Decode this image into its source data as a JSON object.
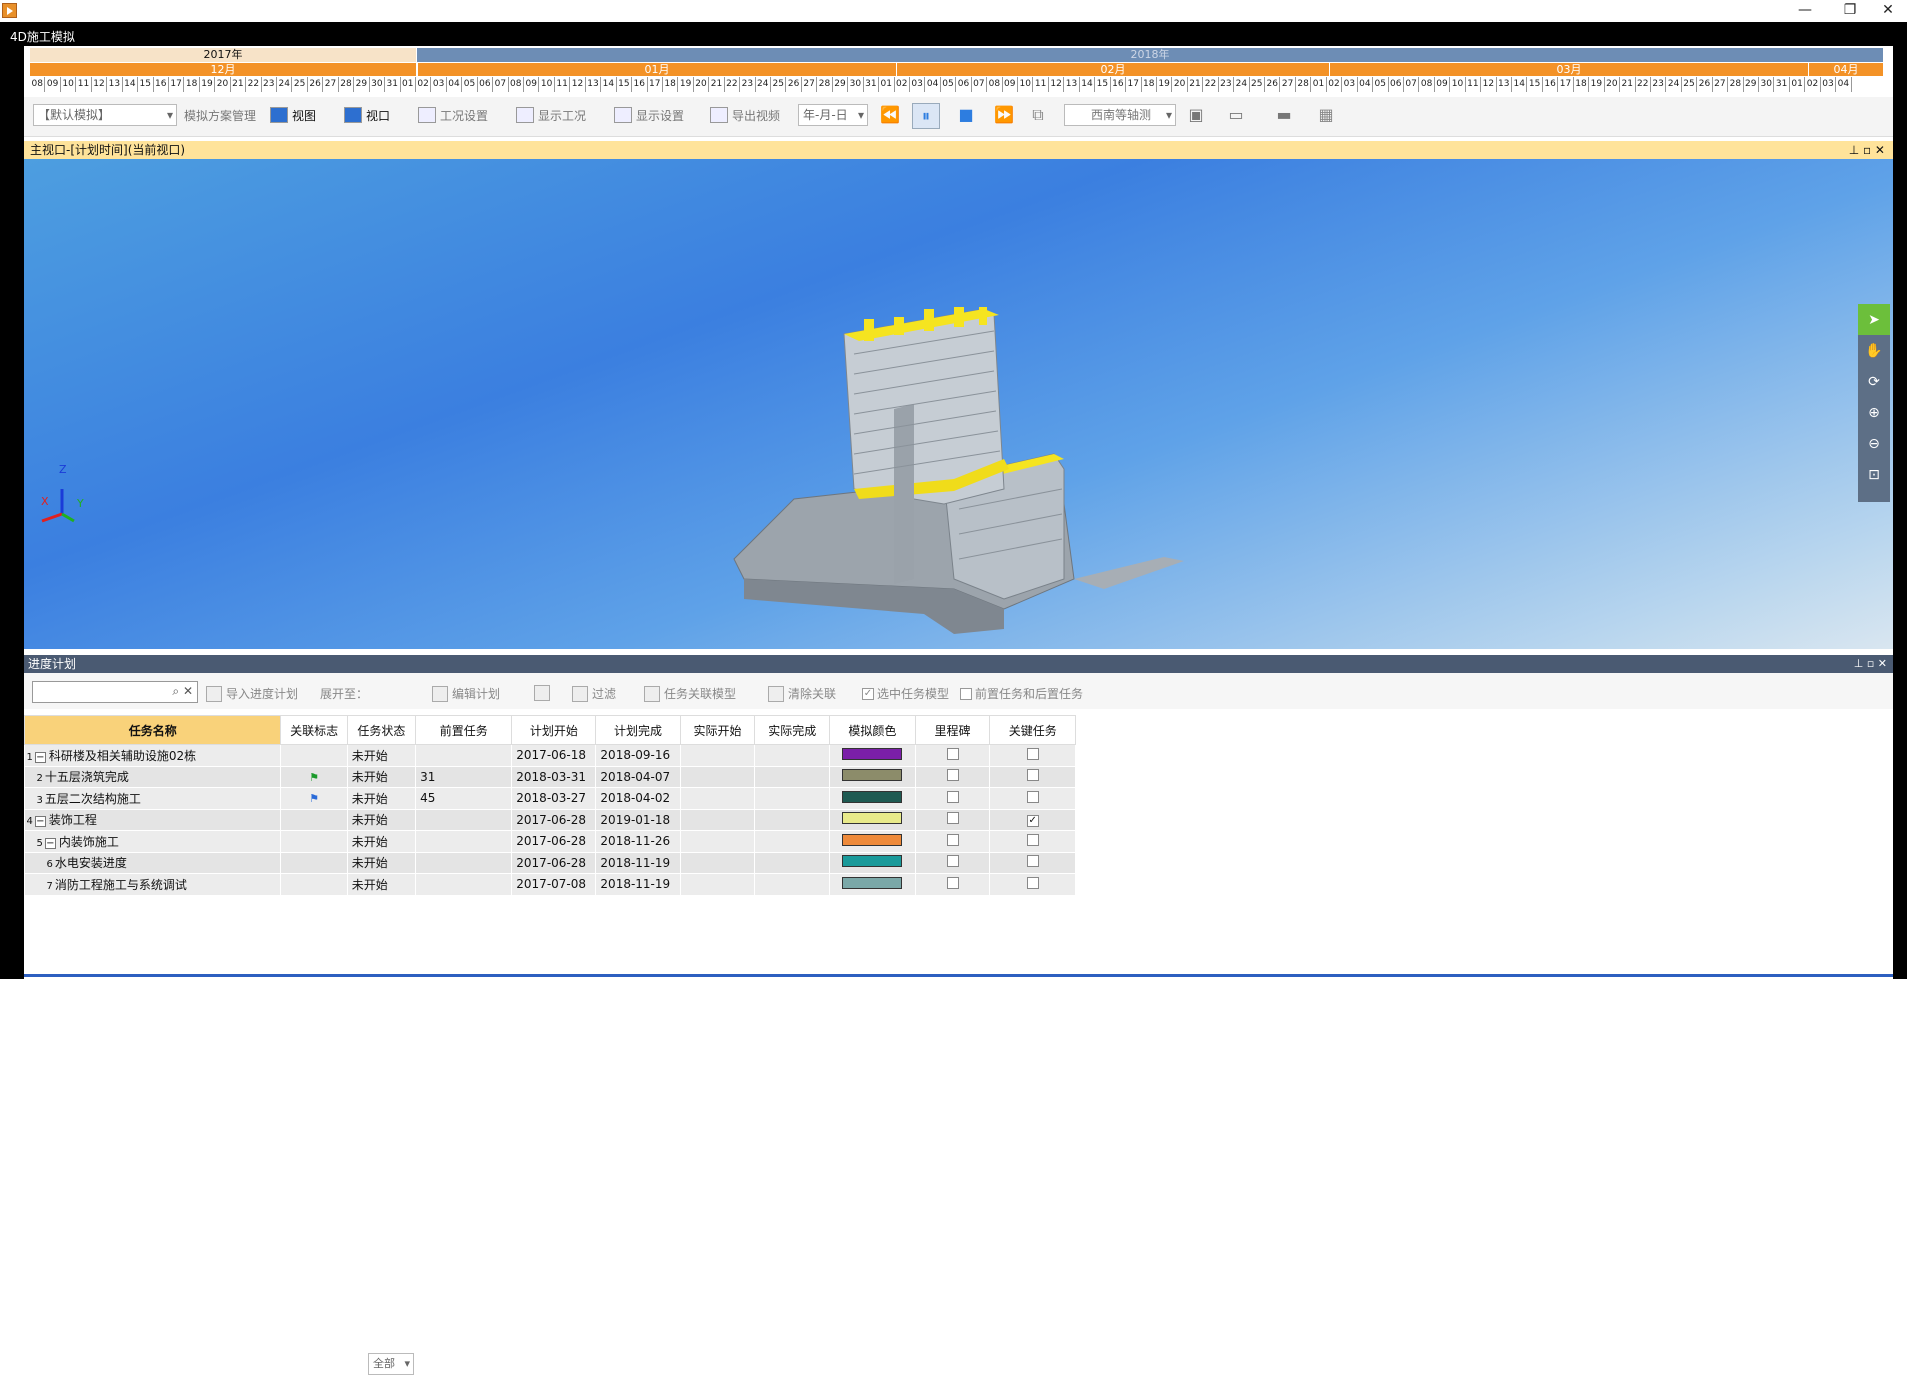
{
  "titlebar": {
    "minimize": "—",
    "restore": "❐",
    "close": "✕"
  },
  "app": {
    "title": "4D施工模拟"
  },
  "timeline": {
    "year1": "2017年",
    "year2": "2018年",
    "months": [
      "12月",
      "01月",
      "02月",
      "03月",
      "04月"
    ],
    "days": [
      "08",
      "09",
      "10",
      "11",
      "12",
      "13",
      "14",
      "15",
      "16",
      "17",
      "18",
      "19",
      "20",
      "21",
      "22",
      "23",
      "24",
      "25",
      "26",
      "27",
      "28",
      "29",
      "30",
      "31",
      "01",
      "02",
      "03",
      "04",
      "05",
      "06",
      "07",
      "08",
      "09",
      "10",
      "11",
      "12",
      "13",
      "14",
      "15",
      "16",
      "17",
      "18",
      "19",
      "20",
      "21",
      "22",
      "23",
      "24",
      "25",
      "26",
      "27",
      "28",
      "29",
      "30",
      "31",
      "01",
      "02",
      "03",
      "04",
      "05",
      "06",
      "07",
      "08",
      "09",
      "10",
      "11",
      "12",
      "13",
      "14",
      "15",
      "16",
      "17",
      "18",
      "19",
      "20",
      "21",
      "22",
      "23",
      "24",
      "25",
      "26",
      "27",
      "28",
      "01",
      "02",
      "03",
      "04",
      "05",
      "06",
      "07",
      "08",
      "09",
      "10",
      "11",
      "12",
      "13",
      "14",
      "15",
      "16",
      "17",
      "18",
      "19",
      "20",
      "21",
      "22",
      "23",
      "24",
      "25",
      "26",
      "27",
      "28",
      "29",
      "30",
      "31",
      "01",
      "02",
      "03",
      "04"
    ]
  },
  "toolbar": {
    "scheme": "【默认模拟】",
    "scheme_mgmt": "模拟方案管理",
    "view": "视图",
    "window": "视口",
    "work_settings": "工况设置",
    "show_work": "显示工况",
    "display_settings": "显示设置",
    "export_video": "导出视频",
    "date_format": "年-月-日",
    "camera": "西南等轴测"
  },
  "viewport": {
    "title": "主视口-[计划时间](当前视口)",
    "axis_z": "Z",
    "axis_x": "X",
    "axis_y": "Y"
  },
  "panel": {
    "title": "进度计划",
    "import": "导入进度计划",
    "expand_to": "展开至：",
    "expand_val": "全部",
    "edit_plan": "编辑计划",
    "filter": "过滤",
    "link_model": "任务关联模型",
    "clear_link": "清除关联",
    "select_model": "选中任务模型",
    "prev_next": "前置任务和后置任务"
  },
  "grid": {
    "headers": [
      "任务名称",
      "关联标志",
      "任务状态",
      "前置任务",
      "计划开始",
      "计划完成",
      "实际开始",
      "实际完成",
      "模拟颜色",
      "里程碑",
      "关键任务"
    ],
    "rows": [
      {
        "num": "1",
        "name": "科研楼及相关辅助设施02栋",
        "status": "未开始",
        "pred": "",
        "start": "2017-06-18",
        "end": "2018-09-16",
        "color": "#7b1fa8",
        "critical": false,
        "flag": "",
        "indent": 0,
        "exp": "−"
      },
      {
        "num": "2",
        "name": "十五层浇筑完成",
        "status": "未开始",
        "pred": "31",
        "start": "2018-03-31",
        "end": "2018-04-07",
        "color": "#8c8c6a",
        "critical": false,
        "flag": "green",
        "indent": 1,
        "exp": ""
      },
      {
        "num": "3",
        "name": "五层二次结构施工",
        "status": "未开始",
        "pred": "45",
        "start": "2018-03-27",
        "end": "2018-04-02",
        "color": "#1e5a52",
        "critical": false,
        "flag": "blue",
        "indent": 1,
        "exp": ""
      },
      {
        "num": "4",
        "name": "装饰工程",
        "status": "未开始",
        "pred": "",
        "start": "2017-06-28",
        "end": "2019-01-18",
        "color": "#e8ea8a",
        "critical": true,
        "flag": "",
        "indent": 0,
        "exp": "−"
      },
      {
        "num": "5",
        "name": "内装饰施工",
        "status": "未开始",
        "pred": "",
        "start": "2017-06-28",
        "end": "2018-11-26",
        "color": "#ee8a3a",
        "critical": false,
        "flag": "",
        "indent": 1,
        "exp": "−"
      },
      {
        "num": "6",
        "name": "水电安装进度",
        "status": "未开始",
        "pred": "",
        "start": "2017-06-28",
        "end": "2018-11-19",
        "color": "#1a9a9a",
        "critical": false,
        "flag": "",
        "indent": 2,
        "exp": ""
      },
      {
        "num": "7",
        "name": "消防工程施工与系统调试",
        "status": "未开始",
        "pred": "",
        "start": "2017-07-08",
        "end": "2018-11-19",
        "color": "#7aa8a8",
        "critical": false,
        "flag": "",
        "indent": 2,
        "exp": ""
      }
    ]
  }
}
